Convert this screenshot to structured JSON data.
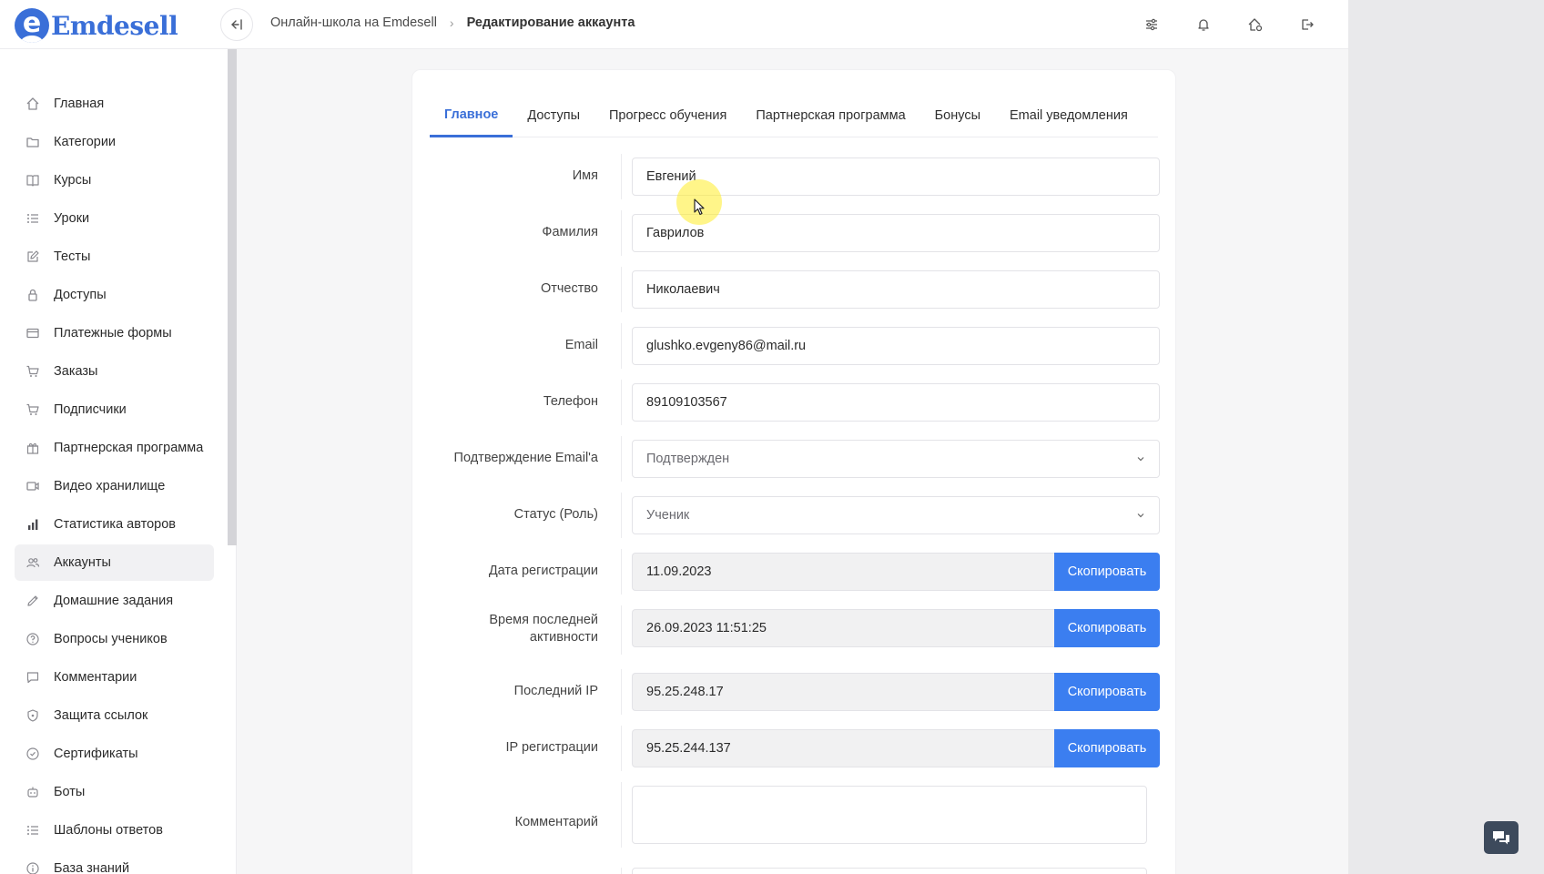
{
  "app": {
    "logo_text": "Emdesell",
    "logo_letter": "e",
    "accent_color": "#3a6fd8",
    "button_color": "#3b7ef0"
  },
  "breadcrumb": {
    "parent": "Онлайн-школа на Emdesell",
    "separator": "›",
    "current": "Редактирование аккаунта"
  },
  "topbar_icons": [
    "sliders-icon",
    "bell-icon",
    "home-settings-icon",
    "logout-icon"
  ],
  "sidebar": {
    "items": [
      {
        "label": "Главная",
        "icon": "home-icon"
      },
      {
        "label": "Категории",
        "icon": "folder-icon"
      },
      {
        "label": "Курсы",
        "icon": "book-icon"
      },
      {
        "label": "Уроки",
        "icon": "list-icon"
      },
      {
        "label": "Тесты",
        "icon": "edit-square-icon"
      },
      {
        "label": "Доступы",
        "icon": "lock-icon"
      },
      {
        "label": "Платежные формы",
        "icon": "credit-card-icon"
      },
      {
        "label": "Заказы",
        "icon": "cart-icon"
      },
      {
        "label": "Подписчики",
        "icon": "cart-icon"
      },
      {
        "label": "Партнерская программа",
        "icon": "gift-icon"
      },
      {
        "label": "Видео хранилище",
        "icon": "video-icon"
      },
      {
        "label": "Статистика авторов",
        "icon": "bar-chart-icon"
      },
      {
        "label": "Аккаунты",
        "icon": "users-icon",
        "active": true
      },
      {
        "label": "Домашние задания",
        "icon": "pencil-icon"
      },
      {
        "label": "Вопросы учеников",
        "icon": "question-circle-icon"
      },
      {
        "label": "Комментарии",
        "icon": "comment-icon"
      },
      {
        "label": "Защита ссылок",
        "icon": "shield-icon"
      },
      {
        "label": "Сертификаты",
        "icon": "check-circle-icon"
      },
      {
        "label": "Боты",
        "icon": "robot-icon"
      },
      {
        "label": "Шаблоны ответов",
        "icon": "list-icon"
      },
      {
        "label": "База знаний",
        "icon": "info-circle-icon"
      }
    ]
  },
  "tabs": [
    {
      "label": "Главное",
      "active": true
    },
    {
      "label": "Доступы"
    },
    {
      "label": "Прогресс обучения"
    },
    {
      "label": "Партнерская программа"
    },
    {
      "label": "Бонусы"
    },
    {
      "label": "Email уведомления"
    }
  ],
  "form": {
    "first_name": {
      "label": "Имя",
      "value": "Евгений"
    },
    "last_name": {
      "label": "Фамилия",
      "value": "Гаврилов"
    },
    "patronymic": {
      "label": "Отчество",
      "value": "Николаевич"
    },
    "email": {
      "label": "Email",
      "value": "glushko.evgeny86@mail.ru"
    },
    "phone": {
      "label": "Телефон",
      "value": "89109103567"
    },
    "email_confirmation": {
      "label": "Подтверждение Email'a",
      "value": "Подтвержден"
    },
    "status_role": {
      "label": "Статус (Роль)",
      "value": "Ученик"
    },
    "registration_date": {
      "label": "Дата регистрации",
      "value": "11.09.2023"
    },
    "last_activity": {
      "label_line1": "Время последней",
      "label_line2": "активности",
      "value": "26.09.2023 11:51:25"
    },
    "last_ip": {
      "label": "Последний IP",
      "value": "95.25.248.17"
    },
    "registration_ip": {
      "label": "IP регистрации",
      "value": "95.25.244.137"
    },
    "comment": {
      "label": "Комментарий",
      "value": ""
    },
    "copy_label": "Скопировать"
  }
}
